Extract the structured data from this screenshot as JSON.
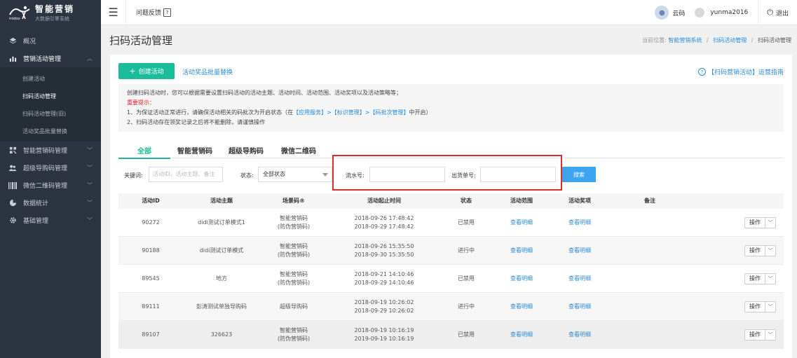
{
  "brand": {
    "title": "智能营销",
    "subtitle": "大数据引擎系统",
    "logo_text": "midoo"
  },
  "sidebar": {
    "items": [
      {
        "label": "概况",
        "icon": "layers-icon"
      },
      {
        "label": "营销活动管理",
        "icon": "chart-icon",
        "open": true
      },
      {
        "label": "智能营销码管理",
        "icon": "qr-icon"
      },
      {
        "label": "超级导购码管理",
        "icon": "users-icon"
      },
      {
        "label": "微信二维码管理",
        "icon": "barcode-icon"
      },
      {
        "label": "数据统计",
        "icon": "pie-icon"
      },
      {
        "label": "基础管理",
        "icon": "gear-icon"
      }
    ],
    "sub_items": [
      {
        "label": "创建活动"
      },
      {
        "label": "扫码活动管理",
        "active": true
      },
      {
        "label": "扫码活动管理(旧)"
      },
      {
        "label": "活动奖品批量替换"
      }
    ]
  },
  "topbar": {
    "feedback": "问题反馈",
    "cloud_code": "云码",
    "username": "yunma2016",
    "logout": "退出"
  },
  "page": {
    "title": "扫码活动管理",
    "breadcrumb": {
      "prefix": "当前位置:",
      "items": [
        "智能营销系统",
        "扫码活动管理"
      ],
      "current": "扫码活动管理"
    }
  },
  "actions": {
    "create": "创建活动",
    "batch_replace": "活动奖品批量替换",
    "guide": "【扫码营销活动】运营指南"
  },
  "notice": {
    "line1": "创建扫码活动时，您可以根据需要设置扫码活动的活动主题、活动时间、活动范围、活动奖项以及活动策略等；",
    "important": "重要提示：",
    "line2_a": "1、为保证活动正常进行，请确保活动相关的码批次为开启状态（在",
    "line2_link": "【应用服务】>【标识管理】>【码批次管理】",
    "line2_b": "中开启）",
    "line3": "2、扫码活动存在领奖记录之后将不能删除，请谨慎操作"
  },
  "tabs": [
    "全部",
    "智能营销码",
    "超级导购码",
    "微信二维码"
  ],
  "filters": {
    "keyword_label": "关键词:",
    "keyword_placeholder": "活动ID、活动主题、备注",
    "status_label": "状态:",
    "status_value": "全部状态",
    "serial_label": "流水号:",
    "shipment_label": "出货单号:",
    "search": "搜索"
  },
  "table": {
    "columns": [
      "活动ID",
      "活动主题",
      "场景码®",
      "活动起止时间",
      "状态",
      "活动范围",
      "活动奖项",
      "备注",
      ""
    ],
    "rows": [
      {
        "id": "90272",
        "theme": "didi测试订单模式1",
        "scene1": "智能营销码",
        "scene2": "(防伪营销码)",
        "start": "2018-09-26 17:48:42",
        "end": "2018-09-29 17:48:42",
        "status": "已禁用",
        "range": "查看明细",
        "prize": "查看明细",
        "note": "",
        "op": "操作"
      },
      {
        "id": "90188",
        "theme": "didi测试订单模式",
        "scene1": "智能营销码",
        "scene2": "(防伪营销码)",
        "start": "2018-09-26 15:35:50",
        "end": "2018-09-30 15:35:50",
        "status": "进行中",
        "range": "查看明细",
        "prize": "查看明细",
        "note": "",
        "op": "操作"
      },
      {
        "id": "89545",
        "theme": "地方",
        "scene1": "智能营销码",
        "scene2": "(防伪营销码)",
        "start": "2018-09-21 14:10:46",
        "end": "2018-09-29 14:10:46",
        "status": "已禁用",
        "range": "查看明细",
        "prize": "查看明细",
        "note": "",
        "op": "操作"
      },
      {
        "id": "89111",
        "theme": "彭涛测试单独导购码",
        "scene1": "超级导购码",
        "scene2": "",
        "start": "2018-09-19 10:26:02",
        "end": "2018-09-29 10:26:02",
        "status": "进行中",
        "range": "查看明细",
        "prize": "查看明细",
        "note": "",
        "op": "操作"
      },
      {
        "id": "89107",
        "theme": "326623",
        "scene1": "智能营销码",
        "scene2": "(防伪营销码)",
        "start": "2018-09-19 10:16:19",
        "end": "2019-09-19 10:16:19",
        "status": "已禁用",
        "range": "查看明细",
        "prize": "查看明细",
        "note": "",
        "op": "操作"
      }
    ]
  },
  "colors": {
    "sidebar_bg": "#2b3440",
    "accent_green": "#1abc9c",
    "link_blue": "#2a8bd6",
    "search_blue": "#3da4f0",
    "highlight_red": "#d9302c"
  }
}
